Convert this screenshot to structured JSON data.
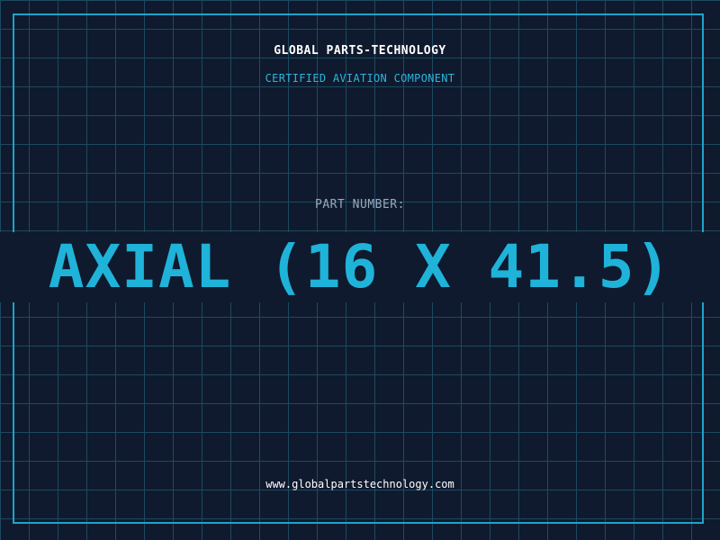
{
  "header": {
    "company": "GLOBAL PARTS-TECHNOLOGY",
    "tagline": "CERTIFIED AVIATION COMPONENT"
  },
  "part": {
    "label": "PART NUMBER:",
    "value": "AXIAL (16 X 41.5)"
  },
  "footer": {
    "website": "www.globalpartstechnology.com"
  },
  "colors": {
    "background": "#0f1a2e",
    "grid": "#1d4a60",
    "accent": "#1fb3d9",
    "label": "#9aa9bd",
    "text": "#ffffff"
  }
}
